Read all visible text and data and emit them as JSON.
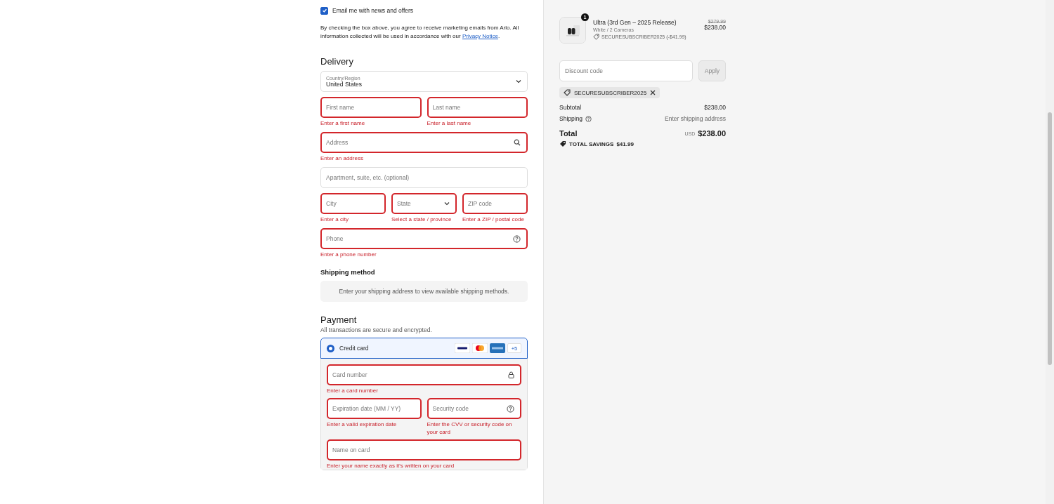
{
  "marketing": {
    "checkbox_label": "Email me with news and offers",
    "checked": true,
    "notice": "By checking the box above, you agree to receive marketing emails from Arlo. All information collected will be used in accordance with our",
    "notice_link": "Privacy Notice",
    "notice_end": "."
  },
  "delivery": {
    "heading": "Delivery",
    "rows": [
      [
        {
          "kind": "select",
          "label": "Country/Region",
          "value": "United States",
          "invalid": false
        }
      ],
      [
        {
          "kind": "input",
          "placeholder": "First name",
          "invalid": true,
          "error": "Enter a first name"
        },
        {
          "kind": "input",
          "placeholder": "Last name",
          "invalid": true,
          "error": "Enter a last name"
        }
      ],
      [
        {
          "kind": "search",
          "placeholder": "Address",
          "invalid": true,
          "error": "Enter an address"
        }
      ],
      [
        {
          "kind": "input",
          "placeholder": "Apartment, suite, etc. (optional)",
          "invalid": false
        }
      ],
      [
        {
          "kind": "input",
          "placeholder": "City",
          "invalid": true,
          "error": "Enter a city"
        },
        {
          "kind": "select",
          "placeholder": "State",
          "invalid": true,
          "error": "Select a state / province"
        },
        {
          "kind": "input",
          "placeholder": "ZIP code",
          "invalid": true,
          "error": "Enter a ZIP / postal code"
        }
      ],
      [
        {
          "kind": "help",
          "placeholder": "Phone",
          "invalid": true,
          "error": "Enter a phone number"
        }
      ]
    ]
  },
  "shipping_method": {
    "heading": "Shipping method",
    "message": "Enter your shipping address to view available shipping methods."
  },
  "payment": {
    "heading": "Payment",
    "subtitle": "All transactions are secure and encrypted.",
    "methods": [
      {
        "label": "Credit card",
        "selected": true,
        "more_brands": "+5"
      }
    ],
    "rows": [
      [
        {
          "kind": "lock",
          "placeholder": "Card number",
          "invalid": true,
          "error": "Enter a card number"
        }
      ],
      [
        {
          "kind": "input",
          "placeholder": "Expiration date (MM / YY)",
          "invalid": true,
          "error": "Enter a valid expiration date"
        },
        {
          "kind": "help",
          "placeholder": "Security code",
          "invalid": true,
          "error": "Enter the CVV or security code on your card"
        }
      ],
      [
        {
          "kind": "input",
          "placeholder": "Name on card",
          "invalid": true,
          "error": "Enter your name exactly as it's written on your card"
        }
      ]
    ]
  },
  "summary": {
    "items": [
      {
        "quantity": "1",
        "title": "Ultra (3rd Gen – 2025 Release)",
        "variant": "White / 2 Cameras",
        "discount": "SECURESUBSCRIBER2025 (-$41.99)",
        "original_price": "$279.99",
        "price": "$238.00"
      }
    ],
    "discount_field": {
      "placeholder": "Discount code"
    },
    "apply_button": {
      "label": "Apply",
      "disabled": true
    },
    "applied_codes": [
      "SECURESUBSCRIBER2025"
    ],
    "subtotal": {
      "label": "Subtotal",
      "value": "$238.00"
    },
    "shipping": {
      "label": "Shipping",
      "value": "Enter shipping address"
    },
    "total": {
      "label": "Total",
      "currency": "USD",
      "value": "$238.00"
    },
    "savings": {
      "label": "TOTAL SAVINGS",
      "value": "$41.99"
    }
  }
}
